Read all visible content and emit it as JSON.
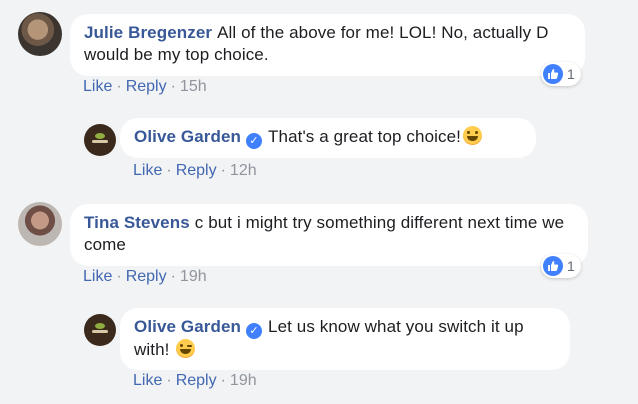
{
  "comments": [
    {
      "author": "Julie Bregenzer",
      "text": "All of the above for me! LOL! No, actually D would be my top choice.",
      "actions": {
        "like": "Like",
        "reply": "Reply",
        "time": "15h"
      },
      "reactions": {
        "icon": "thumbs-up-icon",
        "count": "1"
      }
    },
    {
      "author": "Olive Garden",
      "verified": true,
      "text": "That's a great top choice!",
      "emoji": "grinning-face-icon",
      "actions": {
        "like": "Like",
        "reply": "Reply",
        "time": "12h"
      }
    },
    {
      "author": "Tina Stevens",
      "text": "c but i might try something different next time we come",
      "actions": {
        "like": "Like",
        "reply": "Reply",
        "time": "19h"
      },
      "reactions": {
        "icon": "thumbs-up-icon",
        "count": "1"
      }
    },
    {
      "author": "Olive Garden",
      "verified": true,
      "text": "Let us know what you switch it up with!",
      "emoji": "winking-face-icon",
      "actions": {
        "like": "Like",
        "reply": "Reply",
        "time": "19h"
      }
    }
  ],
  "colors": {
    "background": "#f2f3f5",
    "bubble": "#ffffff",
    "name": "#385898",
    "link": "#4267b2",
    "meta": "#90949c",
    "reaction_blue": "#4080ff"
  },
  "separator": "·"
}
